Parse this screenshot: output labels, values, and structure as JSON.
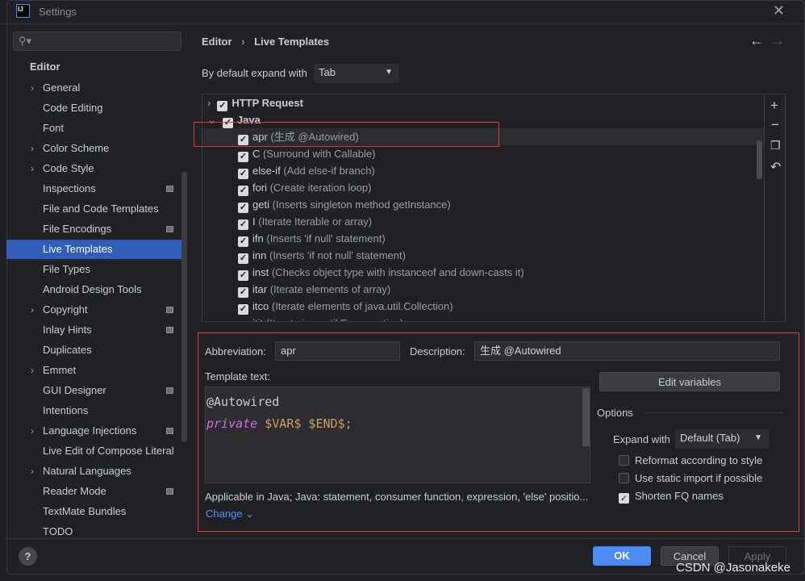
{
  "window": {
    "title": "Settings",
    "logo": "IJ"
  },
  "sidebar": {
    "search_placeholder": "",
    "section": "Editor",
    "items": [
      {
        "label": "General",
        "chevron": true,
        "mark": false
      },
      {
        "label": "Code Editing",
        "chevron": false,
        "mark": false
      },
      {
        "label": "Font",
        "chevron": false,
        "mark": false
      },
      {
        "label": "Color Scheme",
        "chevron": true,
        "mark": false
      },
      {
        "label": "Code Style",
        "chevron": true,
        "mark": false
      },
      {
        "label": "Inspections",
        "chevron": false,
        "mark": true
      },
      {
        "label": "File and Code Templates",
        "chevron": false,
        "mark": false
      },
      {
        "label": "File Encodings",
        "chevron": false,
        "mark": true
      },
      {
        "label": "Live Templates",
        "chevron": false,
        "mark": false,
        "selected": true
      },
      {
        "label": "File Types",
        "chevron": false,
        "mark": false
      },
      {
        "label": "Android Design Tools",
        "chevron": false,
        "mark": false
      },
      {
        "label": "Copyright",
        "chevron": true,
        "mark": true
      },
      {
        "label": "Inlay Hints",
        "chevron": false,
        "mark": true
      },
      {
        "label": "Duplicates",
        "chevron": false,
        "mark": false
      },
      {
        "label": "Emmet",
        "chevron": true,
        "mark": false
      },
      {
        "label": "GUI Designer",
        "chevron": false,
        "mark": true
      },
      {
        "label": "Intentions",
        "chevron": false,
        "mark": false
      },
      {
        "label": "Language Injections",
        "chevron": true,
        "mark": true
      },
      {
        "label": "Live Edit of Compose Literal",
        "chevron": false,
        "mark": false
      },
      {
        "label": "Natural Languages",
        "chevron": true,
        "mark": false
      },
      {
        "label": "Reader Mode",
        "chevron": false,
        "mark": true
      },
      {
        "label": "TextMate Bundles",
        "chevron": false,
        "mark": false
      },
      {
        "label": "TODO",
        "chevron": false,
        "mark": false
      }
    ]
  },
  "breadcrumb": {
    "parent": "Editor",
    "current": "Live Templates"
  },
  "expand": {
    "label": "By default expand with",
    "value": "Tab"
  },
  "groups": [
    {
      "name": "HTTP Request",
      "expanded": false,
      "checked": true
    },
    {
      "name": "Java",
      "expanded": true,
      "checked": true
    }
  ],
  "templates": [
    {
      "abbr": "apr",
      "desc": "(生成 @Autowired)"
    },
    {
      "abbr": "C",
      "desc": "(Surround with Callable)"
    },
    {
      "abbr": "else-if",
      "desc": "(Add else-if branch)"
    },
    {
      "abbr": "fori",
      "desc": "(Create iteration loop)"
    },
    {
      "abbr": "geti",
      "desc": "(Inserts singleton method getInstance)"
    },
    {
      "abbr": "I",
      "desc": "(Iterate Iterable or array)"
    },
    {
      "abbr": "ifn",
      "desc": "(Inserts 'if null' statement)"
    },
    {
      "abbr": "inn",
      "desc": "(Inserts 'if not null' statement)"
    },
    {
      "abbr": "inst",
      "desc": "(Checks object type with instanceof and down-casts it)"
    },
    {
      "abbr": "itar",
      "desc": "(Iterate elements of array)"
    },
    {
      "abbr": "itco",
      "desc": "(Iterate elements of java.util.Collection)"
    },
    {
      "abbr": "itit",
      "desc": "(Iterate java.util.Enumeration)"
    }
  ],
  "editor": {
    "abbr_label": "Abbreviation:",
    "abbr_value": "apr",
    "desc_label": "Description:",
    "desc_value": "生成 @Autowired",
    "template_label": "Template text:",
    "line1": "@Autowired",
    "kw": "private",
    "rest": " $VAR$ $END$;",
    "edit_vars": "Edit variables",
    "options_label": "Options",
    "expand_with_label": "Expand with",
    "expand_with_value": "Default (Tab)",
    "opt1": "Reformat according to style",
    "opt2": "Use static import if possible",
    "opt3": "Shorten FQ names",
    "opt3_checked": true,
    "applicable": "Applicable in Java; Java: statement, consumer function, expression, 'else' positio...",
    "change": "Change"
  },
  "footer": {
    "help": "?",
    "ok": "OK",
    "cancel": "Cancel",
    "apply": "Apply"
  },
  "watermark": "CSDN @Jasonakeke",
  "colors": {
    "accent": "#4c8af5",
    "selection": "#2f5db8",
    "annotation": "#e53935"
  }
}
